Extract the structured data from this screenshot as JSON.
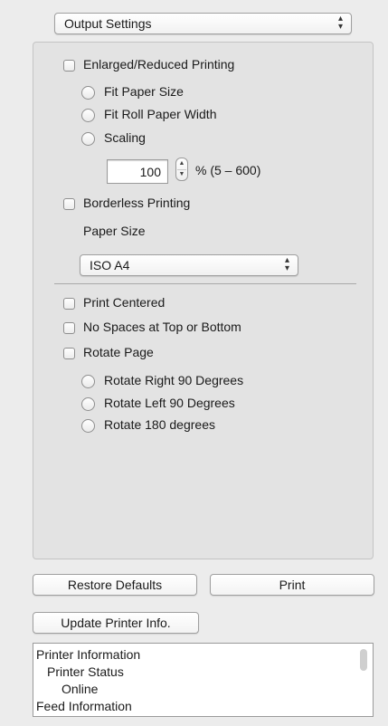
{
  "header": {
    "panel_select": "Output Settings"
  },
  "enlarge": {
    "checkbox_label": "Enlarged/Reduced Printing",
    "options": [
      "Fit Paper Size",
      "Fit Roll Paper Width",
      "Scaling"
    ],
    "scaling_value": "100",
    "range_label": "% (5 – 600)"
  },
  "borderless": {
    "checkbox_label": "Borderless Printing",
    "paper_size_label": "Paper Size",
    "paper_size_value": "ISO A4"
  },
  "layout": {
    "print_centered": "Print Centered",
    "no_spaces": "No Spaces at Top or Bottom",
    "rotate_page": "Rotate Page",
    "rotate_options": [
      "Rotate Right 90 Degrees",
      "Rotate Left 90 Degrees",
      "Rotate 180 degrees"
    ]
  },
  "buttons": {
    "restore": "Restore Defaults",
    "print": "Print",
    "update": "Update Printer Info."
  },
  "info_list": {
    "items": [
      "Printer Information",
      "Printer Status",
      "Online",
      "Feed Information"
    ]
  }
}
